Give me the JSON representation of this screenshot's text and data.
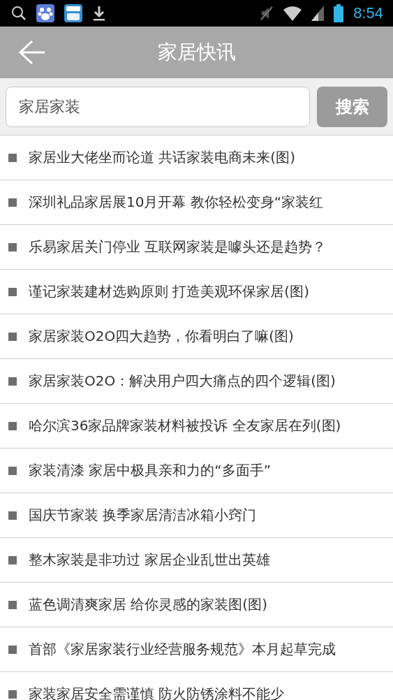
{
  "status_bar": {
    "time": "8:54"
  },
  "header": {
    "title": "家居快讯"
  },
  "search": {
    "value": "家居家装",
    "button": "搜索"
  },
  "news": [
    "家居业大佬坐而论道 共话家装电商未来(图)",
    "深圳礼品家居展10月开幕 教你轻松变身“家装红",
    "乐易家居关门停业 互联网家装是噱头还是趋势？",
    "谨记家装建材选购原则 打造美观环保家居(图)",
    "家居家装O2O四大趋势，你看明白了嘛(图)",
    "家居家装O2O：解决用户四大痛点的四个逻辑(图)",
    "哈尔滨36家品牌家装材料被投诉 全友家居在列(图)",
    "家装清漆 家居中极具亲和力的“多面手”",
    "国庆节家装 换季家居清洁冰箱小窍门",
    "整木家装是非功过 家居企业乱世出英雄",
    "蓝色调清爽家居 给你灵感的家装图(图)",
    "首部《家居家装行业经营服务规范》本月起草完成",
    "家装家居安全需谨慎 防火防锈涂料不能少"
  ]
}
